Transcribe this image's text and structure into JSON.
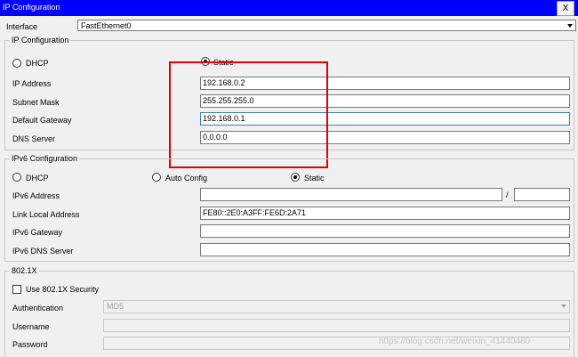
{
  "window": {
    "title": "IP Configuration",
    "close_label": "X"
  },
  "interface": {
    "label": "Interface",
    "value": "FastEthernet0"
  },
  "ipv4": {
    "section_title": "IP Configuration",
    "dhcp_label": "DHCP",
    "static_label": "Static",
    "selected_mode": "Static",
    "ip_address_label": "IP Address",
    "ip_address_value": "192.168.0.2",
    "subnet_mask_label": "Subnet Mask",
    "subnet_mask_value": "255.255.255.0",
    "default_gateway_label": "Default Gateway",
    "default_gateway_value": "192.168.0.1",
    "dns_server_label": "DNS Server",
    "dns_server_value": "0.0.0.0"
  },
  "ipv6": {
    "section_title": "IPv6 Configuration",
    "dhcp_label": "DHCP",
    "auto_config_label": "Auto Config",
    "static_label": "Static",
    "selected_mode": "Static",
    "address_label": "IPv6 Address",
    "address_value": "",
    "prefix_separator": "/",
    "prefix_value": "",
    "link_local_label": "Link Local Address",
    "link_local_value": "FE80::2E0:A3FF:FE6D:2A71",
    "gateway_label": "IPv6 Gateway",
    "gateway_value": "",
    "dns_label": "IPv6 DNS Server",
    "dns_value": ""
  },
  "dot1x": {
    "section_title": "802.1X",
    "use_security_label": "Use 802.1X Security",
    "use_security_checked": false,
    "authentication_label": "Authentication",
    "authentication_value": "MD5",
    "username_label": "Username",
    "username_value": "",
    "password_label": "Password",
    "password_value": ""
  },
  "annotation": {
    "color": "#e00000"
  },
  "watermark": {
    "text": "https://blog.csdn.net/weixin_41440480"
  },
  "colors": {
    "titlebar": "#0000ff",
    "focus_border": "#3c7fb1"
  }
}
